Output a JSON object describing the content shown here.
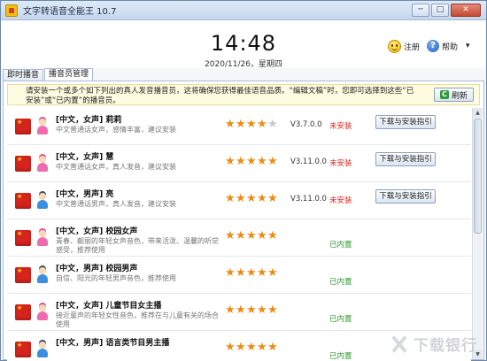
{
  "window": {
    "title": "文字转语音全能王 10.7",
    "min_label": "─",
    "max_label": "□",
    "close_label": "✕"
  },
  "header": {
    "time": "14:48",
    "date": "2020/11/26，星期四",
    "register_label": "注册",
    "help_label": "帮助",
    "dropdown_label": "▾"
  },
  "tabs": [
    {
      "label": "即时播音",
      "active": false
    },
    {
      "label": "播音员管理",
      "active": true
    }
  ],
  "notice": {
    "text": "请安装一个或多个如下列出的真人发音播音员，这将确保您获得最佳语音品质。“编辑文稿”时，您即可选择到这些“已安装”或“已内置”的播音员。",
    "refresh_label": "刷新",
    "refresh_icon": "C"
  },
  "voices": [
    {
      "name": "[中文，女声] 莉莉",
      "desc": "中文普通话女声，感情丰富，建议安装",
      "gender": "female",
      "rating": 4,
      "version": "V3.7.0.0",
      "status": "未安装",
      "installed": false,
      "button": "下载与安装指引"
    },
    {
      "name": "[中文，女声] 慧",
      "desc": "中文普通话女声，真人发音，建议安装",
      "gender": "female",
      "rating": 5,
      "version": "V3.11.0.0",
      "status": "未安装",
      "installed": false,
      "button": "下载与安装指引"
    },
    {
      "name": "[中文，男声] 亮",
      "desc": "中文普通话男声，真人发音，建议安装",
      "gender": "male",
      "rating": 5,
      "version": "V3.11.0.0",
      "status": "未安装",
      "installed": false,
      "button": "下载与安装指引"
    },
    {
      "name": "[中文，女声] 校园女声",
      "desc": "青春、靓丽的年轻女声音色，带来活泼、温馨的听觉感受，推荐使用",
      "gender": "female",
      "rating": 5,
      "version": "",
      "status": "已内置",
      "installed": true,
      "button": ""
    },
    {
      "name": "[中文，男声] 校园男声",
      "desc": "自信、阳光的年轻男声音色，推荐使用",
      "gender": "male",
      "rating": 5,
      "version": "",
      "status": "已内置",
      "installed": true,
      "button": ""
    },
    {
      "name": "[中文，女声] 儿童节目女主播",
      "desc": "接近童声的年轻女性音色，推荐在与儿童有关的场合使用",
      "gender": "female",
      "rating": 5,
      "version": "",
      "status": "已内置",
      "installed": true,
      "button": ""
    },
    {
      "name": "[中文，男声] 语言类节目男主播",
      "desc": "",
      "gender": "male",
      "rating": 5,
      "version": "",
      "status": "已内置",
      "installed": true,
      "button": ""
    }
  ],
  "scrollbar": {
    "up": "▲",
    "down": "▼"
  },
  "watermark": {
    "text": "下载银行"
  }
}
